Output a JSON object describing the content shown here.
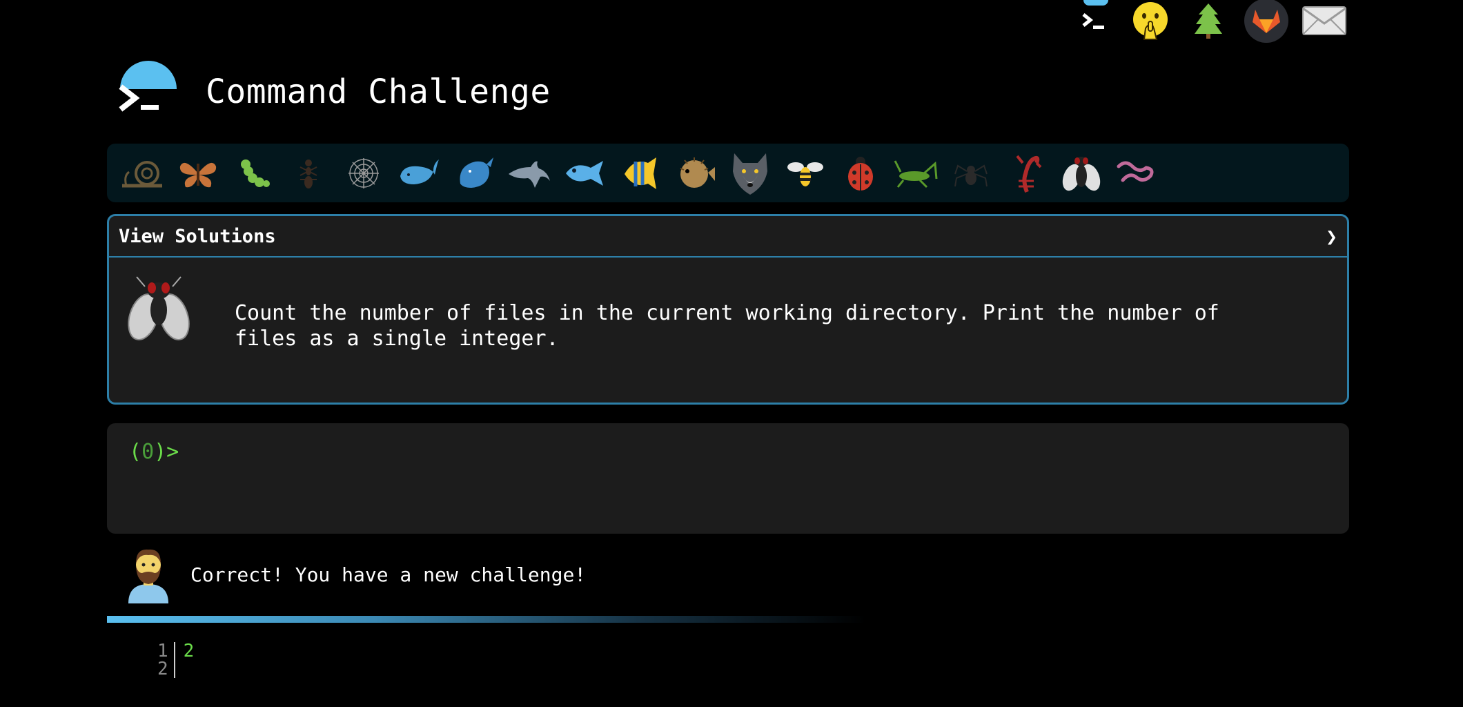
{
  "header": {
    "title": "Command Challenge"
  },
  "top_nav": [
    {
      "name": "terminal-icon"
    },
    {
      "name": "shushing-face-icon"
    },
    {
      "name": "evergreen-tree-icon"
    },
    {
      "name": "gitlab-icon"
    },
    {
      "name": "envelope-icon"
    }
  ],
  "critters": [
    "snail",
    "butterfly",
    "caterpillar",
    "ant",
    "spider-web",
    "whale",
    "whale-2",
    "dolphin",
    "fish",
    "tropical-fish",
    "blowfish",
    "wolf",
    "bee",
    "ladybug",
    "cricket",
    "spider",
    "scorpion",
    "fly",
    "worm"
  ],
  "solutions": {
    "label": "View Solutions",
    "chevron": "❯"
  },
  "challenge": {
    "icon": "fly-icon",
    "text": "Count the number of files in the current working directory. Print the number of\nfiles as a single integer."
  },
  "terminal": {
    "prompt_open": "(",
    "prompt_count": "0",
    "prompt_close": ")>"
  },
  "feedback": {
    "avatar": "bearded-man-icon",
    "message": "Correct! You have a new challenge!"
  },
  "output": {
    "line_numbers": [
      "1",
      "2"
    ],
    "lines": [
      "2",
      ""
    ]
  },
  "colors": {
    "accent": "#5bc0f0",
    "border": "#2d7fa8",
    "prompt_green": "#6bdc4a",
    "panel": "#1c1c1c"
  }
}
